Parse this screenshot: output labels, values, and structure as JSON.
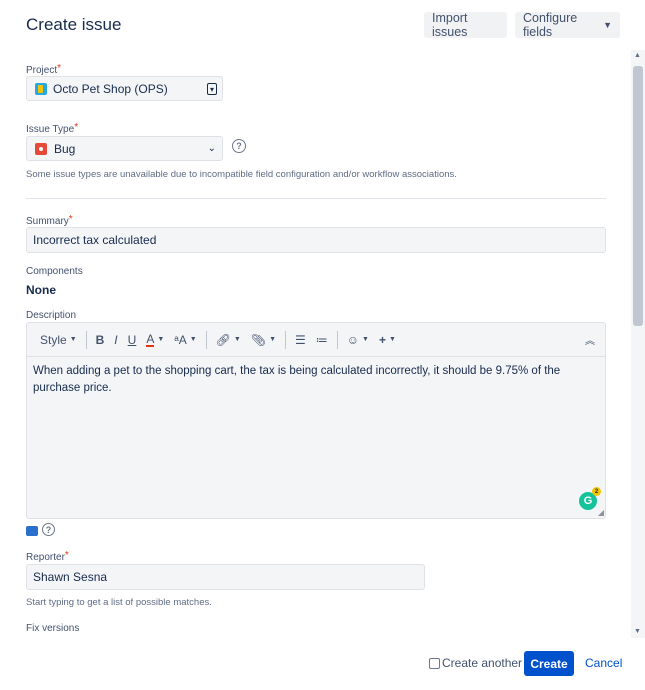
{
  "header": {
    "title": "Create issue",
    "import_label": "Import issues",
    "configure_label": "Configure fields"
  },
  "project": {
    "label": "Project",
    "value": "Octo Pet Shop (OPS)"
  },
  "issue_type": {
    "label": "Issue Type",
    "value": "Bug",
    "hint": "Some issue types are unavailable due to incompatible field configuration and/or workflow associations."
  },
  "summary": {
    "label": "Summary",
    "value": "Incorrect tax calculated"
  },
  "components": {
    "label": "Components",
    "value": "None"
  },
  "description": {
    "label": "Description",
    "toolbar": {
      "style": "Style",
      "bold": "B",
      "italic": "I",
      "underline": "U",
      "text_color": "A"
    },
    "text": "When adding a pet to the shopping cart, the tax is being calculated incorrectly, it should be 9.75% of the purchase price.",
    "grammarly_count": "2"
  },
  "reporter": {
    "label": "Reporter",
    "value": "Shawn Sesna",
    "hint": "Start typing to get a list of possible matches."
  },
  "fix_versions": {
    "label": "Fix versions"
  },
  "footer": {
    "create_another": "Create another",
    "create": "Create",
    "cancel": "Cancel"
  },
  "colors": {
    "primary": "#0052cc",
    "required": "#de350b",
    "field_bg": "#f4f5f7"
  }
}
